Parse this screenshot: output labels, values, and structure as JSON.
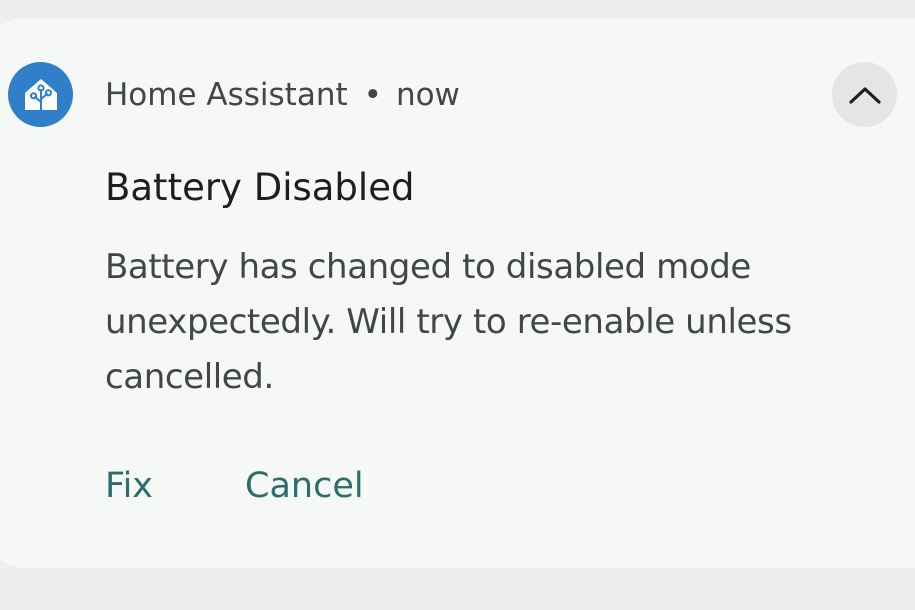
{
  "notification": {
    "app_name": "Home Assistant",
    "separator": "•",
    "time": "now",
    "title": "Battery Disabled",
    "body": "Battery has changed to disabled mode unexpectedly. Will try to re-enable unless cancelled.",
    "app_icon": "home-assistant-icon",
    "collapse_icon": "chevron-up-icon",
    "actions": [
      {
        "label": "Fix"
      },
      {
        "label": "Cancel"
      }
    ]
  },
  "colors": {
    "accent": "#2b6e6b",
    "app_icon_bg": "#2f7fc9",
    "card_bg": "#f6f8f5"
  }
}
